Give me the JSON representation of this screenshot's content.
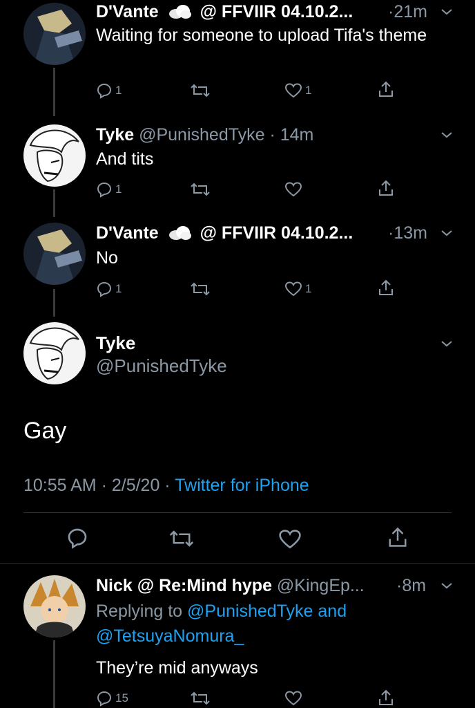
{
  "colors": {
    "background": "#000000",
    "text": "#ffffff",
    "muted": "#8b98a5",
    "link": "#1da1f2",
    "line": "#3a3a3c"
  },
  "tweets": [
    {
      "name": "D'Vante",
      "emoji": "cloud-icon",
      "handle": "@ FFVIIR 04.10.2...",
      "time": "·21m",
      "text": "Waiting for someone to upload Tifa's theme",
      "replies": "1",
      "retweets": "",
      "likes": "1"
    },
    {
      "name": "Tyke",
      "handle": "@PunishedTyke",
      "time": "· 14m",
      "text": "And tits",
      "replies": "1",
      "retweets": "",
      "likes": ""
    },
    {
      "name": "D'Vante",
      "emoji": "cloud-icon",
      "handle": "@ FFVIIR 04.10.2...",
      "time": "·13m",
      "text": "No",
      "replies": "1",
      "retweets": "",
      "likes": "1"
    }
  ],
  "main_tweet": {
    "name": "Tyke",
    "handle": "@PunishedTyke",
    "text": "Gay",
    "timestamp": "10:55 AM · 2/5/20 · ",
    "source": "Twitter for iPhone"
  },
  "reply": {
    "name": "Nick @ Re:Mind hype",
    "handle": "@KingEp...",
    "time": "·8m",
    "replying_prefix": "Replying to ",
    "replying_user1": "@PunishedTyke",
    "replying_and": " and",
    "replying_user2": "@TetsuyaNomura_",
    "text": "They’re mid anyways",
    "replies": "15"
  }
}
